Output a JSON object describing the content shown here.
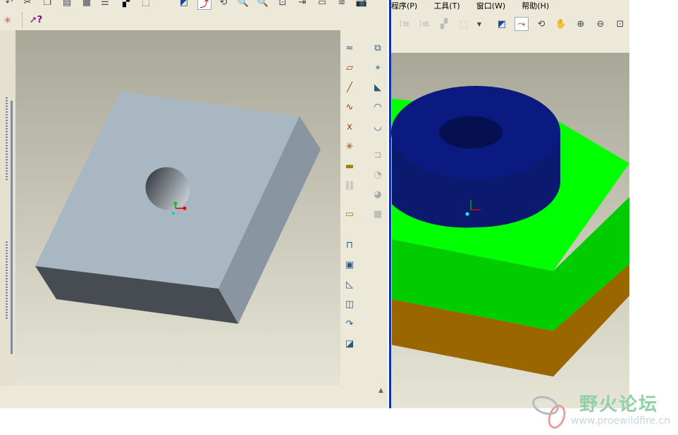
{
  "left_window": {
    "toolbar_icons": [
      "undo-icon",
      "cut-icon",
      "copy-icon",
      "paste-icon",
      "table-icon",
      "list-icon",
      "binoculars-icon",
      "select-box-icon",
      "repaint-icon",
      "datum-display-icon",
      "spin-icon",
      "zoom-in-icon",
      "zoom-out-icon",
      "refit-icon",
      "orient-icon",
      "saved-views-icon",
      "layers-icon",
      "camera-icon"
    ],
    "help_icon": "whats-this-icon",
    "feature_icons": [
      "sketch-curve-icon",
      "datum-plane-icon",
      "datum-axis-icon",
      "datum-curve-icon",
      "datum-point-icon",
      "coordinate-system-icon",
      "analysis-icon",
      "chain-icon",
      "note-icon",
      "extrude-icon",
      "revolve-icon",
      "sweep-icon",
      "blend-icon",
      "boundary-icon",
      "mirror-icon",
      "merge-icon",
      "pattern-icon",
      "hole-icon",
      "shell-icon",
      "rib-icon",
      "draft-icon",
      "round-icon",
      "chamfer-icon"
    ]
  },
  "right_window": {
    "menu": [
      "程序(P)",
      "工具(T)",
      "窗口(W)",
      "帮助(H)"
    ],
    "toolbar_icons": [
      "regen-icon",
      "regen-manager-icon",
      "find-icon",
      "select-box-icon",
      "repaint-icon",
      "spin-center-icon",
      "orient-mode-icon",
      "pan-icon",
      "zoom-in-icon",
      "zoom-out-icon",
      "refit-icon"
    ]
  },
  "watermark": {
    "title": "野火论坛",
    "url": "www.proewildfire.cn"
  },
  "colors": {
    "toolbar": "#ece9d8",
    "green_top": "#00ff00",
    "green_side": "#00cc00",
    "brown": "#996600",
    "cylinder": "#0a1a80",
    "plate": "#a9b7c3"
  }
}
